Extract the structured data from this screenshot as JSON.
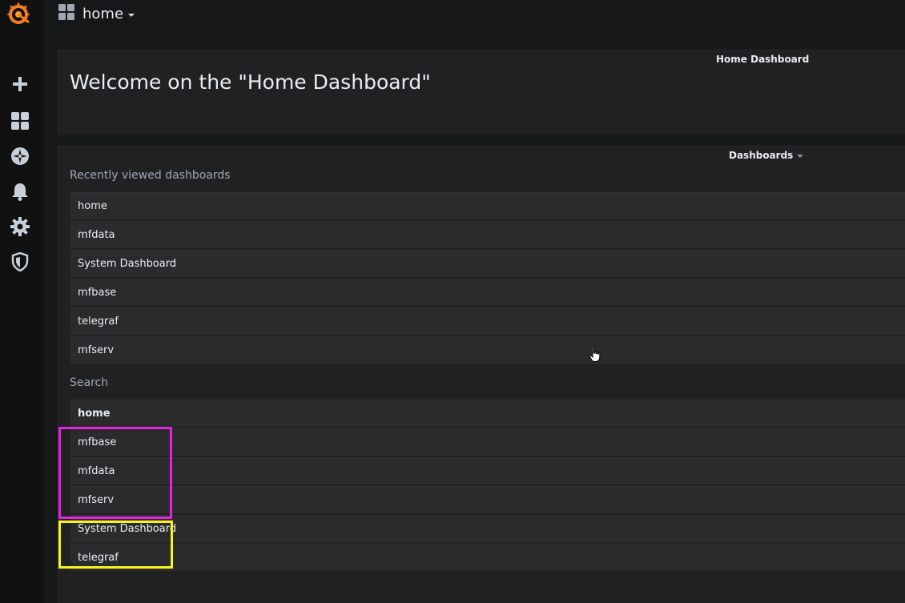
{
  "topbar": {
    "dashboard_title": "home"
  },
  "sidemenu": {
    "items": [
      {
        "icon": "plus-icon"
      },
      {
        "icon": "dashboards-grid-icon"
      },
      {
        "icon": "explore-compass-icon"
      },
      {
        "icon": "alerting-bell-icon"
      },
      {
        "icon": "configuration-gear-icon"
      },
      {
        "icon": "shield-icon"
      }
    ]
  },
  "welcome_panel": {
    "title": "Home Dashboard",
    "text": "Welcome on the \"Home Dashboard\""
  },
  "dashboards_panel": {
    "title": "Dashboards",
    "recent": {
      "heading": "Recently viewed dashboards",
      "items": [
        "home",
        "mfdata",
        "System Dashboard",
        "mfbase",
        "telegraf",
        "mfserv"
      ]
    },
    "search": {
      "heading": "Search",
      "items": [
        "home",
        "mfbase",
        "mfdata",
        "mfserv",
        "System Dashboard",
        "telegraf"
      ]
    }
  },
  "colors": {
    "highlight_magenta": "#e024e0",
    "highlight_yellow": "#f5f51a",
    "background": "#161719",
    "panel": "#212124",
    "list_item": "#2b2b2e"
  }
}
